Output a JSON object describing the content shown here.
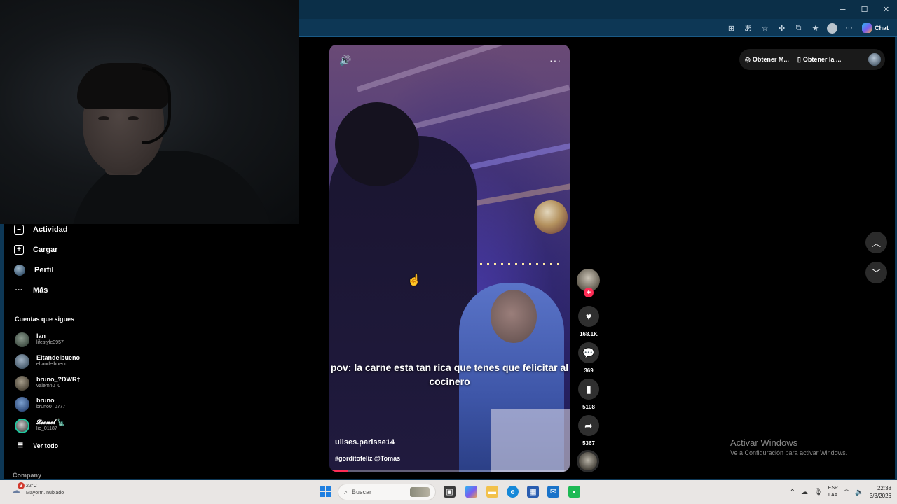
{
  "browser": {
    "window_controls": {
      "minimize": "─",
      "maximize": "☐",
      "close": "✕"
    },
    "chat_label": "Chat"
  },
  "sidebar": {
    "nav": [
      {
        "label": "Actividad",
        "icon": "activity-icon"
      },
      {
        "label": "Cargar",
        "icon": "upload-icon"
      },
      {
        "label": "Perfil",
        "icon": "profile-avatar"
      },
      {
        "label": "Más",
        "icon": "more-dots-icon"
      }
    ],
    "following_title": "Cuentas que sigues",
    "following": [
      {
        "name": "Ian",
        "handle": "lifestyle3957"
      },
      {
        "name": "Eltandelbueno",
        "handle": "eltandelbueno"
      },
      {
        "name": "bruno_?DWR†",
        "handle": "valemn0_0"
      },
      {
        "name": "bruno",
        "handle": "bruno0_0777"
      },
      {
        "name": "𝓛𝓲𝓸𝓷𝓮𝓵 🗽",
        "handle": "lio_01187"
      }
    ],
    "see_all": "Ver todo",
    "company": "Company"
  },
  "video": {
    "caption": "pov: la carne esta tan rica que tenes que felicitar al cocinero",
    "author": "ulises.parisse14",
    "tags": "#gorditofeliz @Tomas",
    "progress": 0.08
  },
  "actions": {
    "likes": "168.1K",
    "comments": "369",
    "saves": "5108",
    "shares": "5367"
  },
  "top_right": {
    "item1": "Obtener M...",
    "item2": "Obtener la ..."
  },
  "watermark": {
    "title": "Activar Windows",
    "subtitle": "Ve a Configuración para activar Windows."
  },
  "taskbar": {
    "weather_badge": "3",
    "temperature": "22°C",
    "weather_desc": "Mayorm. nublado",
    "search_placeholder": "Buscar",
    "lang_top": "ESP",
    "lang_bottom": "LAA",
    "time": "22:38",
    "date": "3/3/2026"
  }
}
